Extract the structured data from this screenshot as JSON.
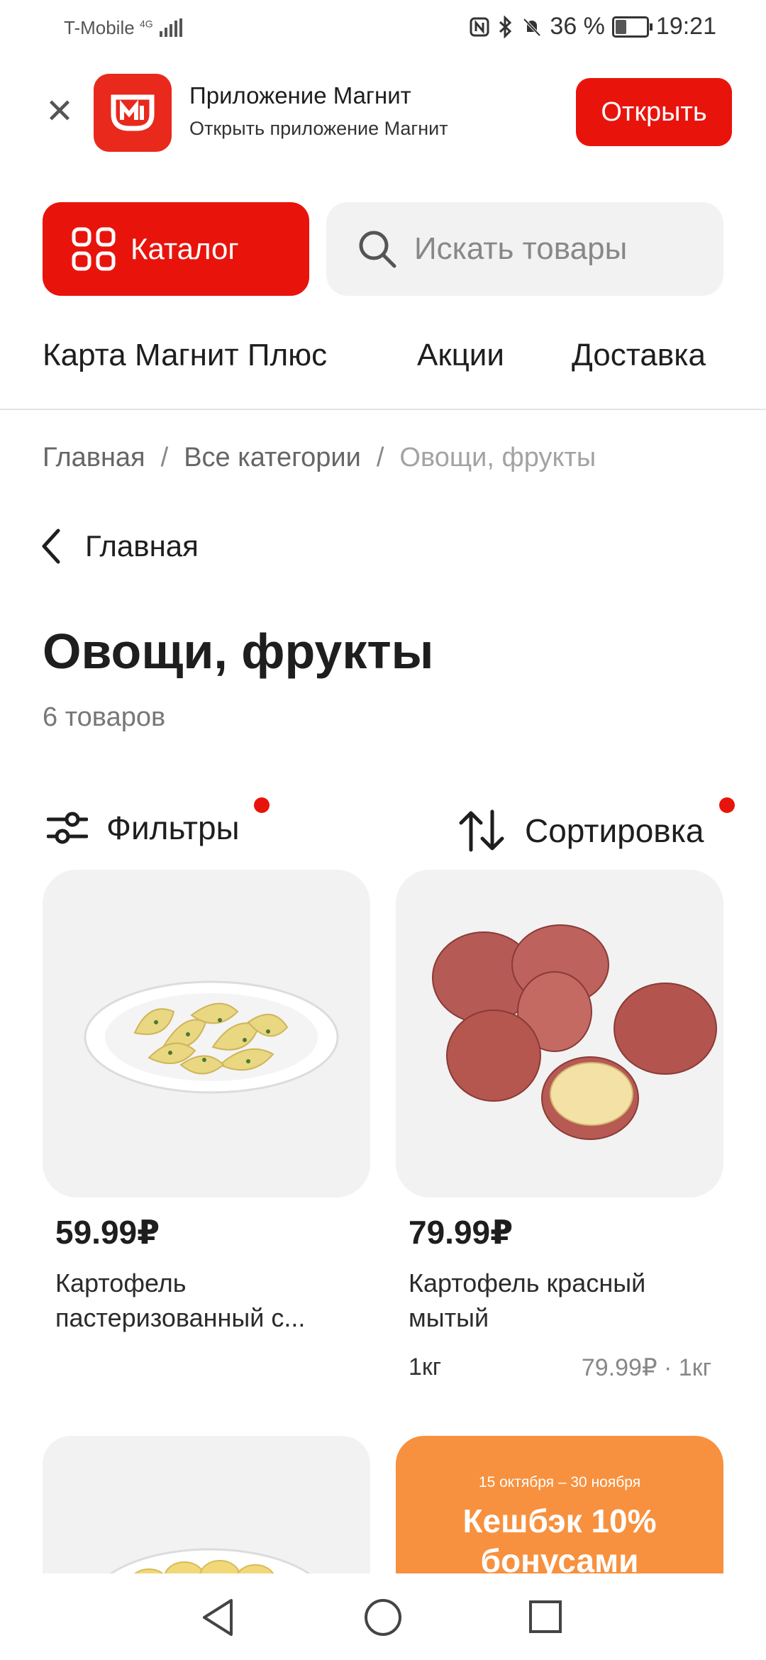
{
  "status_bar": {
    "carrier": "T-Mobile",
    "network": "4G",
    "battery": "36 %",
    "battery_level": 0.36,
    "time": "19:21"
  },
  "app_banner": {
    "title": "Приложение Магнит",
    "subtitle": "Открыть приложение Магнит",
    "open_label": "Открыть"
  },
  "header": {
    "catalog_label": "Каталог",
    "search_placeholder": "Искать товары"
  },
  "nav": {
    "items": [
      {
        "label": "Карта Магнит Плюс"
      },
      {
        "label": "Акции"
      },
      {
        "label": "Доставка"
      }
    ]
  },
  "breadcrumbs": {
    "items": [
      "Главная",
      "Все категории",
      "Овощи, фрукты"
    ],
    "separator": "/"
  },
  "back": {
    "label": "Главная"
  },
  "page": {
    "title": "Овощи, фрукты",
    "count": "6 товаров"
  },
  "controls": {
    "filters_label": "Фильтры",
    "sort_label": "Сортировка"
  },
  "products": [
    {
      "price": "59.99₽",
      "name_line1": "Картофель",
      "name_line2": "пастеризованный с...",
      "image": "potato-wedges-plate"
    },
    {
      "price": "79.99₽",
      "name_line1": "Картофель красный",
      "name_line2": "мытый",
      "weight": "1кг",
      "unit_price": "79.99₽ · 1кг",
      "image": "red-potatoes"
    }
  ],
  "promo": {
    "date": "15 октября – 30 ноября",
    "line1": "Кешбэк 10%",
    "line2": "бонусами"
  },
  "colors": {
    "brand_red": "#e8140c",
    "promo_orange": "#f7913f",
    "card_bg": "#f2f2f2"
  }
}
